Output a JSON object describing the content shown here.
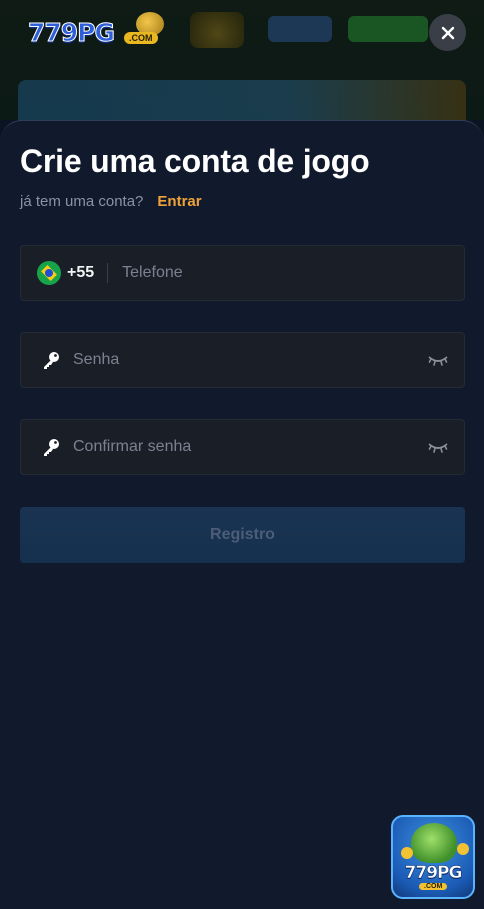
{
  "background": {
    "logo": {
      "text": "779PG",
      "badge": ".COM"
    }
  },
  "modal": {
    "title": "Crie uma conta de jogo",
    "prompt": "já tem uma conta?",
    "login_link": "Entrar",
    "phone": {
      "country_code": "+55",
      "placeholder": "Telefone",
      "flag": "brazil-flag"
    },
    "password": {
      "placeholder": "Senha",
      "icon": "key-icon",
      "toggle_icon": "eye-closed-icon"
    },
    "confirm_password": {
      "placeholder": "Confirmar senha",
      "icon": "key-icon",
      "toggle_icon": "eye-closed-icon"
    },
    "register_label": "Registro"
  },
  "app_badge": {
    "text": "779PG",
    "sub": ".COM"
  },
  "colors": {
    "modal_bg": "#111a2d",
    "field_bg": "#1a1e27",
    "accent_link": "#f0a23a",
    "button_bg": "#15304f",
    "button_text": "#4c5d78"
  }
}
